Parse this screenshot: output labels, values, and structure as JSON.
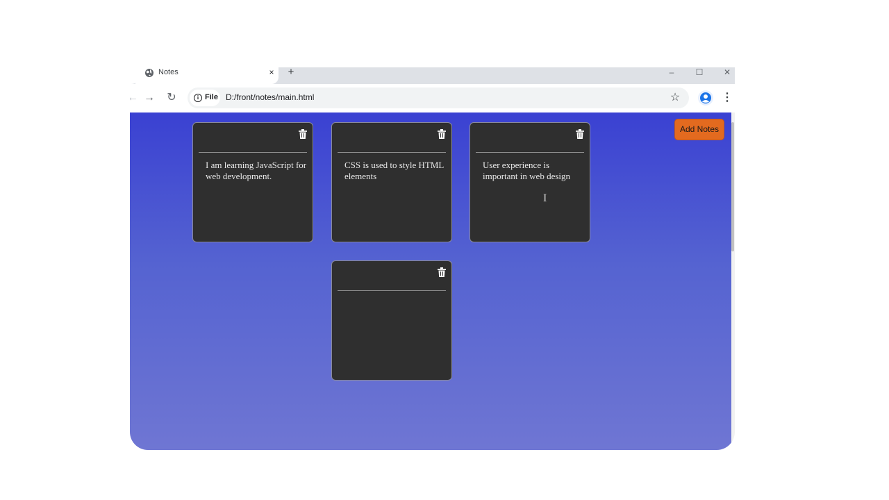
{
  "browser": {
    "tab_title": "Notes",
    "tab_close": "×",
    "new_tab": "+",
    "window_controls": {
      "minimize": "–",
      "maximize": "☐",
      "close": "✕"
    },
    "nav": {
      "back": "←",
      "forward": "→",
      "reload": "↻"
    },
    "address": {
      "chip_label": "File",
      "url": "D:/front/notes/main.html"
    },
    "bookmark_star": "☆",
    "menu": "⋮"
  },
  "page": {
    "add_button_label": "Add Notes",
    "background_gradient": [
      "#3a41d2",
      "#5563d1",
      "#6f76d3"
    ],
    "note_background": "#2f2f2f",
    "accent_color": "#e36a1f",
    "notes": [
      {
        "text": "I am learning JavaScript for web development.",
        "icon": "trash-icon"
      },
      {
        "text": "CSS is used to style HTML elements",
        "icon": "trash-icon"
      },
      {
        "text": "User experience is important in web design",
        "icon": "trash-icon"
      },
      {
        "text": "",
        "icon": "trash-icon"
      }
    ]
  }
}
